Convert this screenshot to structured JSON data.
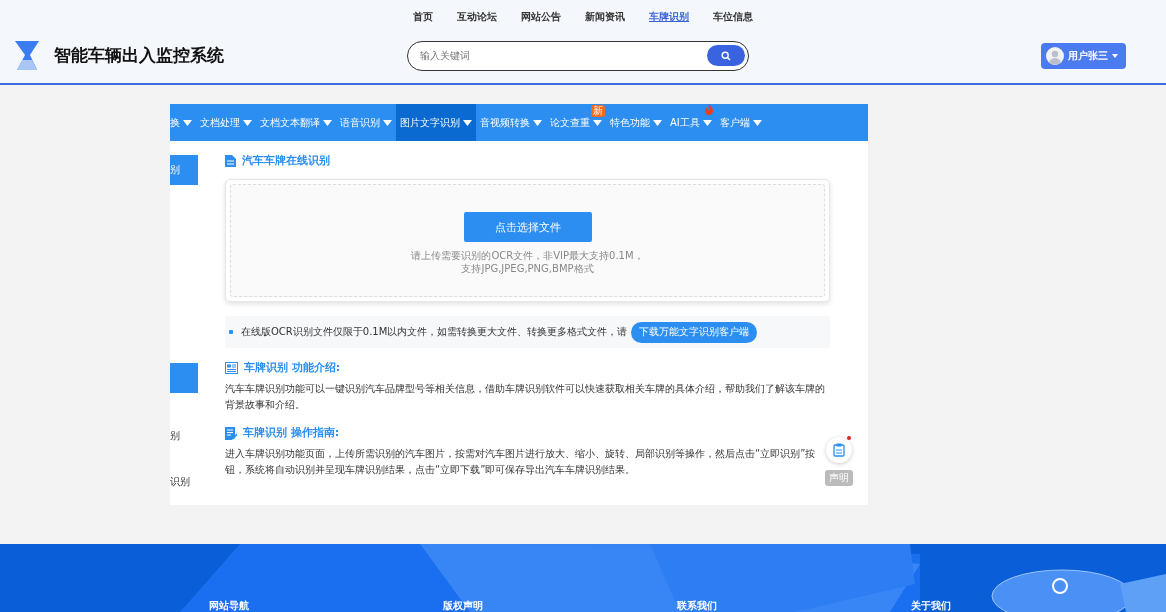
{
  "header": {
    "top_links": [
      {
        "label": "首页",
        "selected": false
      },
      {
        "label": "互动论坛",
        "selected": false
      },
      {
        "label": "网站公告",
        "selected": false
      },
      {
        "label": "新闻资讯",
        "selected": false
      },
      {
        "label": "车牌识别",
        "selected": true
      },
      {
        "label": "车位信息",
        "selected": false
      }
    ],
    "title": "智能车辆出入监控系统",
    "search": {
      "placeholder": "输入关键词"
    },
    "user": {
      "name": "用户张三"
    }
  },
  "menu": [
    {
      "label": "换",
      "selected": false,
      "hot": false
    },
    {
      "label": "文档处理",
      "selected": false,
      "hot": false
    },
    {
      "label": "文档文本翻译",
      "selected": false,
      "hot": false
    },
    {
      "label": "语音识别",
      "selected": false,
      "hot": false
    },
    {
      "label": "图片文字识别",
      "selected": true,
      "hot": false
    },
    {
      "label": "音视频转换",
      "selected": false,
      "hot": false
    },
    {
      "label": "论文查重",
      "selected": false,
      "hot": false,
      "badge": "新"
    },
    {
      "label": "特色功能",
      "selected": false,
      "hot": false
    },
    {
      "label": "AI工具",
      "selected": false,
      "hot": true
    },
    {
      "label": "客户端",
      "selected": false,
      "hot": false
    }
  ],
  "sidebar": [
    {
      "label": "别",
      "selected": true
    },
    {
      "selected": true
    },
    {
      "label": "别",
      "selected": false
    },
    {
      "label": "识别",
      "selected": false
    }
  ],
  "upload": {
    "title": "汽车车牌在线识别",
    "button": "点击选择文件",
    "hint_lines": [
      "请上传需要识别的OCR文件，非VIP最大支持0.1M，",
      "支持JPG,JPEG,PNG,BMP格式"
    ]
  },
  "notice": {
    "text": "在线版OCR识别文件仅限于0.1M以内文件，如需转换更大文件、转换更多格式文件，请",
    "button": "下载万能文字识别客户端"
  },
  "sections": [
    {
      "kind": "intro",
      "title": "车牌识别 功能介绍:",
      "text": "汽车车牌识别功能可以一键识别汽车品牌型号等相关信息，借助车牌识别软件可以快速获取相关车牌的具体介绍，帮助我们了解该车牌的背景故事和介绍。"
    },
    {
      "kind": "guide",
      "title": "车牌识别 操作指南:",
      "text": "进入车牌识别功能页面，上传所需识别的汽车图片，按需对汽车图片进行放大、缩小、旋转、局部识别等操作，然后点击“立即识别”按钮，系统将自动识别并呈现车牌识别结果，点击“立即下载”即可保存导出汽车车牌识别结果。"
    }
  ],
  "float_widget": {
    "label": "声明",
    "unread": true
  },
  "footer": {
    "links": [
      "网站导航",
      "版权声明",
      "联系我们",
      "关于我们"
    ]
  }
}
